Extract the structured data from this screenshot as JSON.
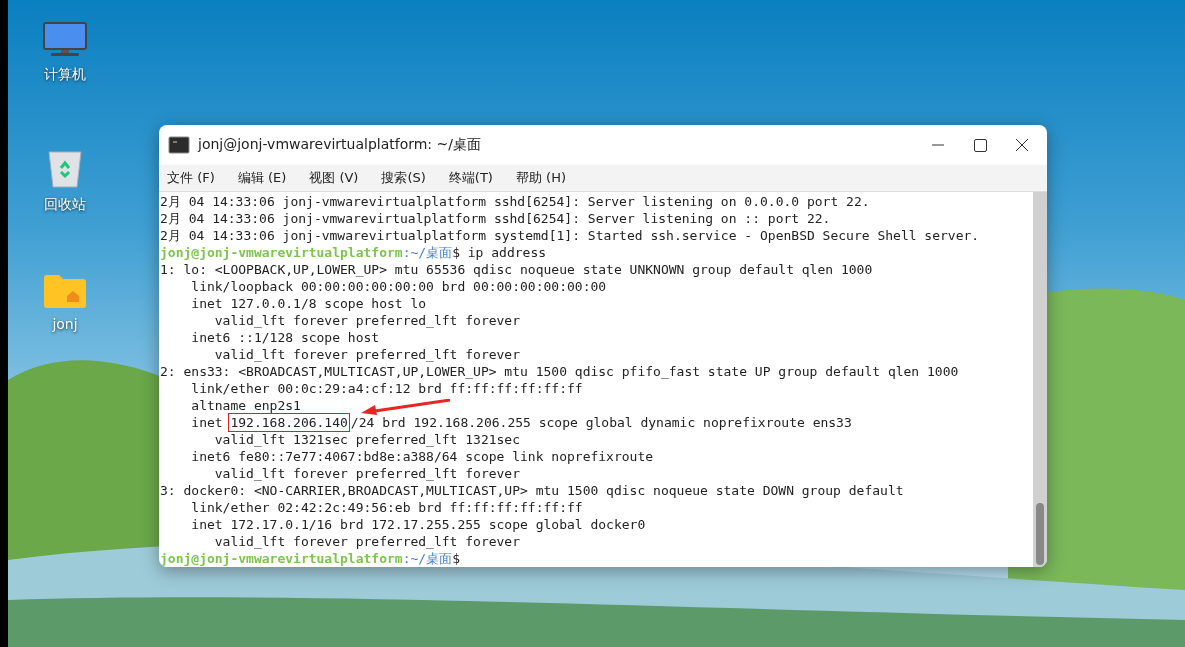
{
  "desktop_icons": [
    {
      "kind": "computer",
      "label": "计算机"
    },
    {
      "kind": "trash",
      "label": "回收站"
    },
    {
      "kind": "folder",
      "label": "jonj"
    }
  ],
  "window": {
    "title": "jonj@jonj-vmwarevirtualplatform: ~/桌面"
  },
  "menu": [
    "文件 (F)",
    "编辑 (E)",
    "视图 (V)",
    "搜索(S)",
    "终端(T)",
    "帮助 (H)"
  ],
  "terminal": [
    {
      "kind": "output",
      "text": "2月 04 14:33:06 jonj-vmwarevirtualplatform sshd[6254]: Server listening on 0.0.0.0 port 22."
    },
    {
      "kind": "output",
      "text": "2月 04 14:33:06 jonj-vmwarevirtualplatform sshd[6254]: Server listening on :: port 22."
    },
    {
      "kind": "output",
      "text": "2月 04 14:33:06 jonj-vmwarevirtualplatform systemd[1]: Started ssh.service - OpenBSD Secure Shell server."
    },
    {
      "kind": "prompt",
      "user": "jonj@jonj-vmwarevirtualplatform",
      "path": ":~/桌面",
      "command": "$ ip address"
    },
    {
      "kind": "output",
      "text": "1: lo: <LOOPBACK,UP,LOWER_UP> mtu 65536 qdisc noqueue state UNKNOWN group default qlen 1000"
    },
    {
      "kind": "output",
      "text": "    link/loopback 00:00:00:00:00:00 brd 00:00:00:00:00:00"
    },
    {
      "kind": "output",
      "text": "    inet 127.0.0.1/8 scope host lo"
    },
    {
      "kind": "output",
      "text": "       valid_lft forever preferred_lft forever"
    },
    {
      "kind": "output",
      "text": "    inet6 ::1/128 scope host"
    },
    {
      "kind": "output",
      "text": "       valid_lft forever preferred_lft forever"
    },
    {
      "kind": "output",
      "text": "2: ens33: <BROADCAST,MULTICAST,UP,LOWER_UP> mtu 1500 qdisc pfifo_fast state UP group default qlen 1000"
    },
    {
      "kind": "output",
      "text": "    link/ether 00:0c:29:a4:cf:12 brd ff:ff:ff:ff:ff:ff"
    },
    {
      "kind": "output",
      "text": "    altname enp2s1"
    },
    {
      "kind": "highlighted",
      "before": "    inet ",
      "mark": "192.168.206.140",
      "after": "/24 brd 192.168.206.255 scope global dynamic noprefixroute ens33"
    },
    {
      "kind": "output",
      "text": "       valid_lft 1321sec preferred_lft 1321sec"
    },
    {
      "kind": "output",
      "text": "    inet6 fe80::7e77:4067:bd8e:a388/64 scope link noprefixroute"
    },
    {
      "kind": "output",
      "text": "       valid_lft forever preferred_lft forever"
    },
    {
      "kind": "output",
      "text": "3: docker0: <NO-CARRIER,BROADCAST,MULTICAST,UP> mtu 1500 qdisc noqueue state DOWN group default"
    },
    {
      "kind": "output",
      "text": "    link/ether 02:42:2c:49:56:eb brd ff:ff:ff:ff:ff:ff"
    },
    {
      "kind": "output",
      "text": "    inet 172.17.0.1/16 brd 172.17.255.255 scope global docker0"
    },
    {
      "kind": "output",
      "text": "       valid_lft forever preferred_lft forever"
    },
    {
      "kind": "prompt",
      "user": "jonj@jonj-vmwarevirtualplatform",
      "path": ":~/桌面",
      "command": "$"
    }
  ]
}
